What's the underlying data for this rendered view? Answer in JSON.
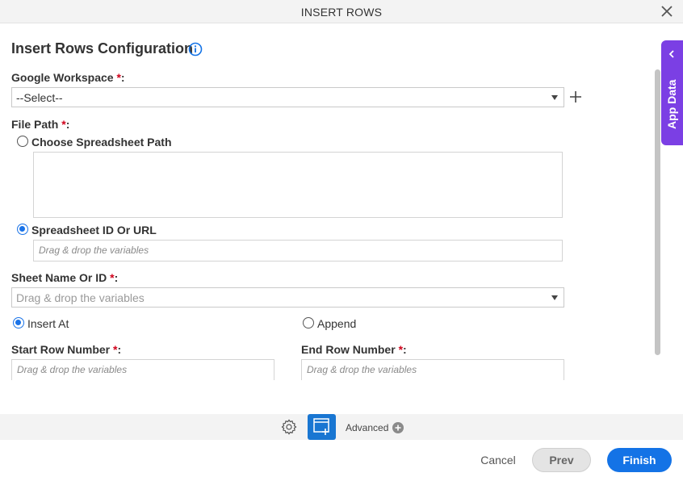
{
  "window": {
    "title": "INSERT ROWS"
  },
  "section": {
    "title": "Insert Rows Configuration"
  },
  "google_workspace": {
    "label": "Google Workspace",
    "required_mark": "*",
    "colon": ":",
    "value": "--Select--"
  },
  "file_path": {
    "label": "File Path",
    "required_mark": "*",
    "colon": ":",
    "option_choose": "Choose Spreadsheet Path",
    "option_id": "Spreadsheet ID Or URL",
    "id_placeholder": "Drag & drop the variables"
  },
  "sheet_name": {
    "label": "Sheet Name Or ID",
    "required_mark": "*",
    "colon": ":",
    "placeholder": "Drag & drop the variables"
  },
  "mode": {
    "insert_at": "Insert At",
    "append": "Append"
  },
  "start_row": {
    "label": "Start Row Number",
    "required_mark": "*",
    "colon": ":",
    "placeholder": "Drag & drop the variables"
  },
  "end_row": {
    "label": "End Row Number",
    "required_mark": "*",
    "colon": ":",
    "placeholder": "Drag & drop the variables"
  },
  "side_panel": {
    "label": "App Data"
  },
  "toolbar": {
    "advanced_label": "Advanced"
  },
  "actions": {
    "cancel": "Cancel",
    "prev": "Prev",
    "finish": "Finish"
  },
  "colors": {
    "accent": "#1473e6",
    "app_data": "#7b3fe4",
    "required": "#d0021b"
  }
}
